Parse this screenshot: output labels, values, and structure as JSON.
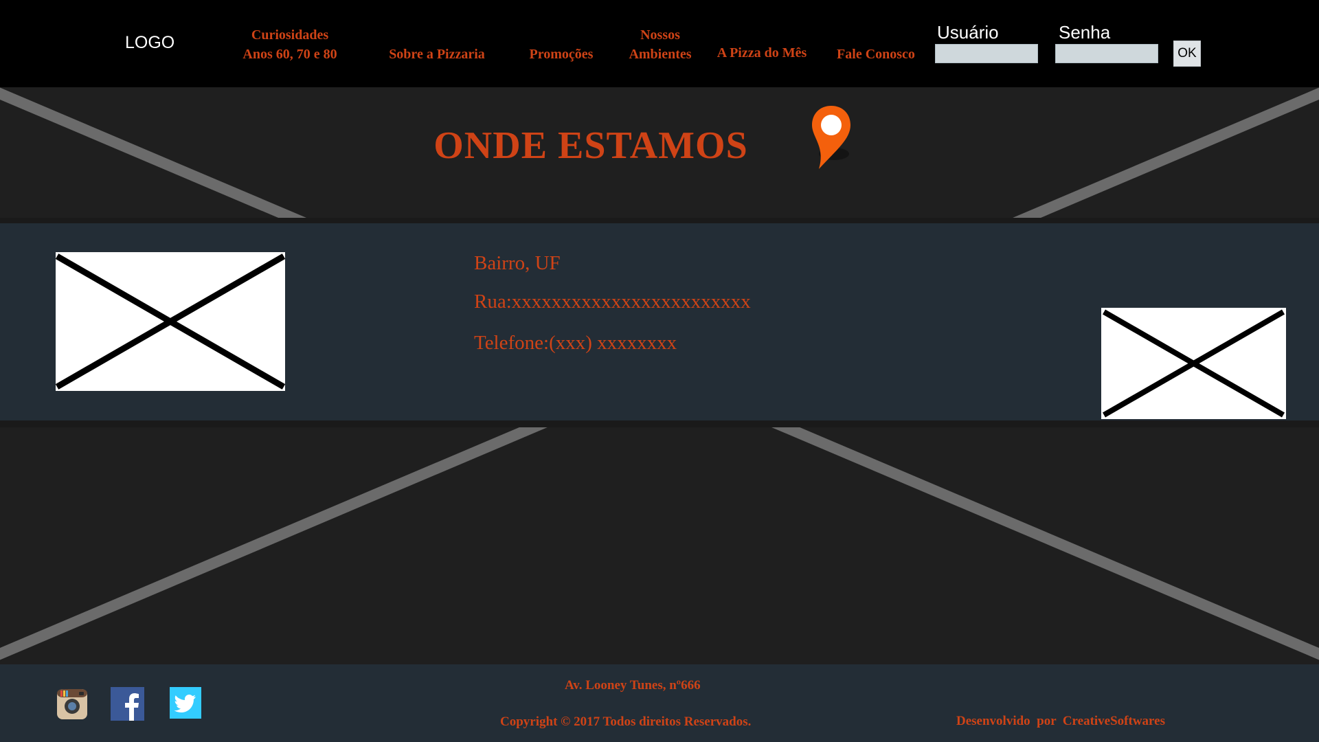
{
  "header": {
    "logo": "LOGO",
    "nav": [
      {
        "line1": "Curiosidades",
        "line2": "Anos 60, 70 e 80"
      },
      {
        "line1": "",
        "line2": "Sobre a Pizzaria"
      },
      {
        "line1": "",
        "line2": "Promoções"
      },
      {
        "line1": "Nossos",
        "line2": "Ambientes"
      },
      {
        "line1": "",
        "line2": "A Pizza do Mês"
      },
      {
        "line1": "",
        "line2": "Fale Conosco"
      }
    ],
    "login": {
      "user_label": "Usuário",
      "user_value": "",
      "password_label": "Senha",
      "password_value": "",
      "ok_label": "OK"
    }
  },
  "main": {
    "title": "ONDE ESTAMOS",
    "title_icon": "location-pin-icon",
    "info": {
      "neighborhood": "Bairro, UF",
      "street": "Rua:xxxxxxxxxxxxxxxxxxxxxxxx",
      "phone": "Telefone:(xxx) xxxxxxxx"
    }
  },
  "footer": {
    "social": [
      "instagram-icon",
      "facebook-icon",
      "twitter-icon"
    ],
    "address": "Av. Looney Tunes, nº666",
    "copyright": "Copyright © 2017 Todos direitos Reservados.",
    "developer": "Desenvolvido  por  CreativeSoftwares"
  },
  "colors": {
    "accent": "#cf4316",
    "header_bg": "#000000",
    "page_bg": "#1f1f1f",
    "band_bg": "#232d36",
    "pin": "#f4600c"
  }
}
